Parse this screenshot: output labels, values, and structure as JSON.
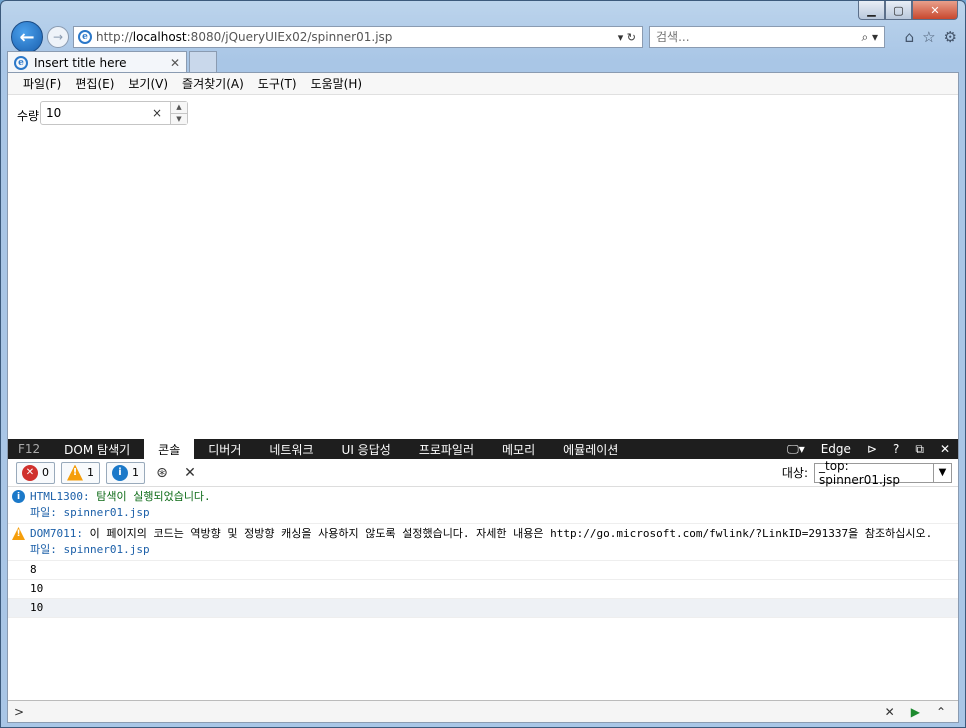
{
  "window": {
    "controls": {
      "minimize": "▁",
      "maximize": "▢",
      "close": "✕"
    }
  },
  "nav": {
    "back_icon": "arrow-left-icon",
    "forward_icon": "arrow-right-icon",
    "url_prefix": "http://",
    "url_host": "localhost",
    "url_rest": ":8080/jQueryUIEx02/spinner01.jsp",
    "address_tools": "▾ ↻",
    "search_placeholder": "검색...",
    "search_tools": "⌕ ▾",
    "right_icons": [
      "⌂",
      "☆",
      "⚙"
    ]
  },
  "tab": {
    "title": "Insert title here",
    "close": "✕"
  },
  "menu": [
    "파일(F)",
    "편집(E)",
    "보기(V)",
    "즐겨찾기(A)",
    "도구(T)",
    "도움말(H)"
  ],
  "page": {
    "label": "수량",
    "spinner_value": "10",
    "clear": "×",
    "up": "▲",
    "down": "▼"
  },
  "devtools": {
    "f12": "F12",
    "tabs": [
      "DOM 탐색기",
      "콘솔",
      "디버거",
      "네트워크",
      "UI 응답성",
      "프로파일러",
      "메모리",
      "에뮬레이션"
    ],
    "active_tab_index": 1,
    "right": {
      "mode_icon": "🖵▾",
      "edge": "Edge",
      "console_icon": "⊳",
      "help": "?",
      "dock": "⧉",
      "close": "✕"
    },
    "toolbar": {
      "errors": "0",
      "warnings": "1",
      "infos": "1",
      "target_label": "대상:",
      "target_value": "_top: spinner01.jsp"
    },
    "messages": [
      {
        "kind": "info",
        "code": "HTML1300:",
        "text": " 탐색이 실행되었습니다.",
        "file": "파일: spinner01.jsp"
      },
      {
        "kind": "warn",
        "code": "DOM7011:",
        "text": " 이 페이지의 코드는 역방향 및 정방향 캐싱을 사용하지 않도록 설정했습니다. 자세한 내용은 http://go.microsoft.com/fwlink/?LinkID=291337을 참조하십시오.",
        "file": "파일: spinner01.jsp"
      }
    ],
    "logs": [
      "8",
      "10",
      "10"
    ],
    "input_prompt": ">",
    "input_tools": [
      "✕",
      "▶",
      "⌃"
    ]
  },
  "colors": {
    "devbar_bg": "#1e1e1e",
    "info_blue": "#1b79c9",
    "warn_orange": "#f59e0b",
    "error_red": "#d0312d"
  }
}
